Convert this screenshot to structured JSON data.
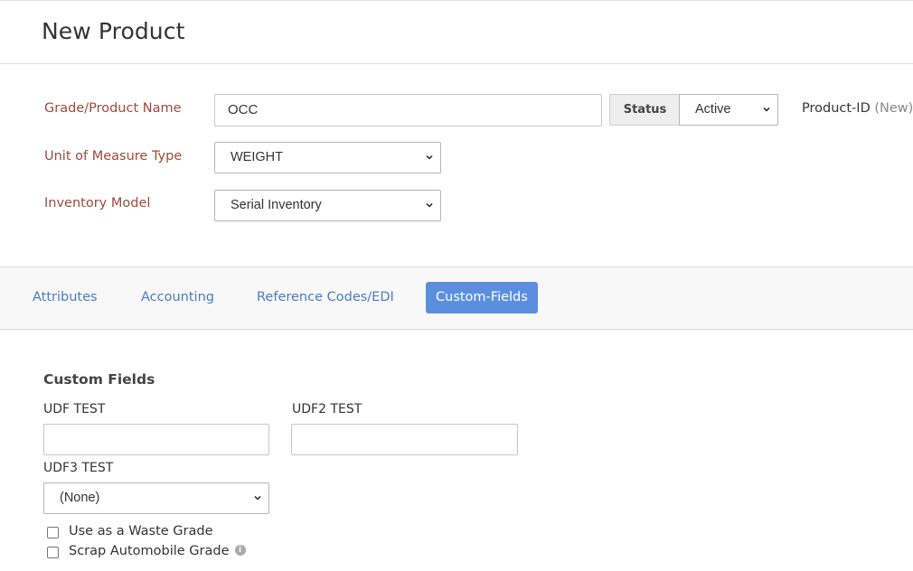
{
  "page": {
    "title": "New Product"
  },
  "form": {
    "grade_name": {
      "label": "Grade/Product Name",
      "value": "OCC"
    },
    "status": {
      "label": "Status",
      "value": "Active"
    },
    "product_id": {
      "label": "Product-ID",
      "value": "(New)"
    },
    "uom_type": {
      "label": "Unit of Measure Type",
      "value": "WEIGHT"
    },
    "inventory_model": {
      "label": "Inventory Model",
      "value": "Serial Inventory"
    }
  },
  "tabs": [
    {
      "label": "Attributes",
      "active": false
    },
    {
      "label": "Accounting",
      "active": false
    },
    {
      "label": "Reference Codes/EDI",
      "active": false
    },
    {
      "label": "Custom-Fields",
      "active": true
    }
  ],
  "custom_fields": {
    "title": "Custom Fields",
    "udf_test": {
      "label": "UDF TEST",
      "value": ""
    },
    "udf2_test": {
      "label": "UDF2 TEST",
      "value": ""
    },
    "udf3_test": {
      "label": "UDF3 TEST",
      "value": "(None)"
    },
    "waste_grade": {
      "label": "Use as a Waste Grade",
      "checked": false
    },
    "scrap_auto": {
      "label": "Scrap Automobile Grade",
      "checked": false
    }
  },
  "icons": {
    "info": "info-icon",
    "dropdown": "chevron-down-icon"
  },
  "colors": {
    "label": "#9c4a3c",
    "link": "#4a7cc1",
    "active_tab": "#5b8fdd"
  }
}
